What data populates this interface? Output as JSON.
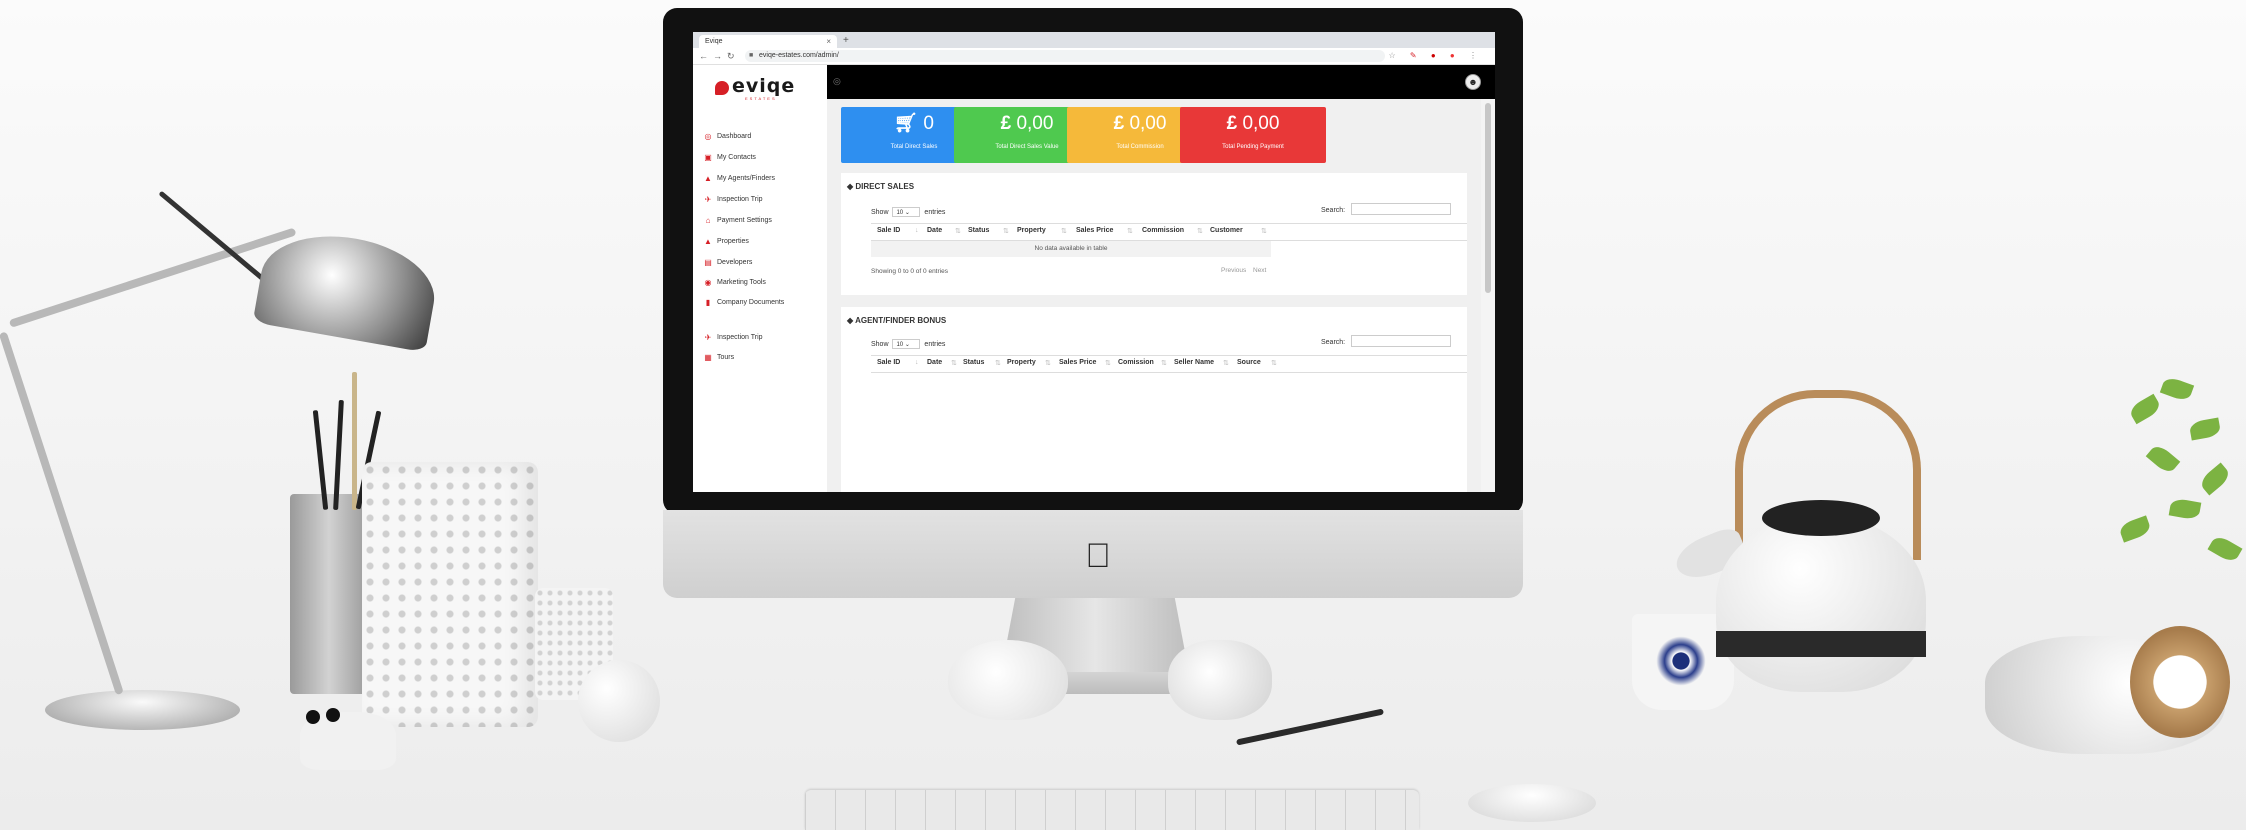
{
  "browser": {
    "tab_title": "Eviqe",
    "tab_close": "×",
    "new_tab": "+",
    "url": "eviqe-estates.com/admin/"
  },
  "logo": {
    "text": "eviqe",
    "subtitle": "ESTATES"
  },
  "sidebar": {
    "items": [
      {
        "label": "Dashboard",
        "icon": "dashboard-icon"
      },
      {
        "label": "My Contacts",
        "icon": "contacts-icon"
      },
      {
        "label": "My Agents/Finders",
        "icon": "user-icon"
      },
      {
        "label": "Inspection Trip",
        "icon": "plane-icon"
      },
      {
        "label": "Payment Settings",
        "icon": "bank-icon"
      },
      {
        "label": "Properties",
        "icon": "home-icon"
      },
      {
        "label": "Developers",
        "icon": "building-icon"
      },
      {
        "label": "Marketing Tools",
        "icon": "globe-icon"
      },
      {
        "label": "Company Documents",
        "icon": "document-icon"
      },
      {
        "label": "Inspection Trip",
        "icon": "plane-icon"
      },
      {
        "label": "Tours",
        "icon": "calendar-icon"
      }
    ]
  },
  "stats": [
    {
      "value": "0",
      "label": "Total Direct Sales",
      "color": "#2e8ff0",
      "icon": "cart-icon"
    },
    {
      "value": "0,00",
      "label": "Total Direct Sales Value",
      "color": "#4fc94f",
      "icon": "pound-icon"
    },
    {
      "value": "0,00",
      "label": "Total Commission",
      "color": "#f5b93a",
      "icon": "pound-icon"
    },
    {
      "value": "0,00",
      "label": "Total Pending Payment",
      "color": "#e83838",
      "icon": "pound-icon"
    }
  ],
  "currency_symbol": "£",
  "direct_sales": {
    "title": "DIRECT SALES",
    "show_prefix": "Show",
    "show_value": "10",
    "show_suffix": "entries",
    "search_label": "Search:",
    "columns": [
      "Sale ID",
      "Date",
      "Status",
      "Property",
      "Sales Price",
      "Commission",
      "Customer"
    ],
    "empty_text": "No data available in table",
    "info": "Showing 0 to 0 of 0 entries",
    "prev": "Previous",
    "next": "Next"
  },
  "agent_bonus": {
    "title": "AGENT/FINDER BONUS",
    "show_prefix": "Show",
    "show_value": "10",
    "show_suffix": "entries",
    "search_label": "Search:",
    "columns": [
      "Sale ID",
      "Date",
      "Status",
      "Property",
      "Sales Price",
      "Comission",
      "Seller Name",
      "Source"
    ]
  }
}
